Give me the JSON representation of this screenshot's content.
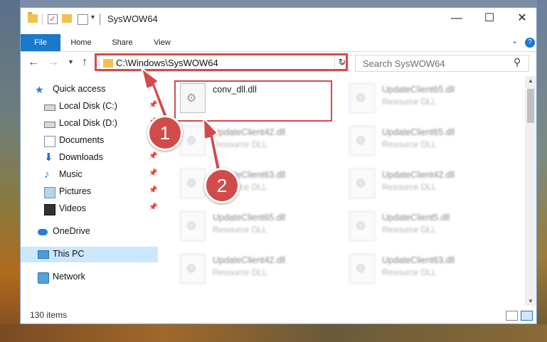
{
  "window": {
    "title": "SysWOW64",
    "minimize_glyph": "—",
    "maximize_glyph": "☐",
    "close_glyph": "✕"
  },
  "ribbon": {
    "tabs": [
      "File",
      "Home",
      "Share",
      "View"
    ]
  },
  "address": {
    "path": "C:\\Windows\\SysWOW64",
    "search_placeholder": "Search SysWOW64"
  },
  "sidebar": {
    "items": [
      {
        "label": "Quick access",
        "icon": "star-icon",
        "pinned": false
      },
      {
        "label": "Local Disk (C:)",
        "icon": "disk-icon",
        "pinned": true
      },
      {
        "label": "Local Disk (D:)",
        "icon": "disk-icon",
        "pinned": true
      },
      {
        "label": "Documents",
        "icon": "documents-icon",
        "pinned": true
      },
      {
        "label": "Downloads",
        "icon": "download-icon",
        "pinned": true
      },
      {
        "label": "Music",
        "icon": "music-icon",
        "pinned": true
      },
      {
        "label": "Pictures",
        "icon": "pictures-icon",
        "pinned": true
      },
      {
        "label": "Videos",
        "icon": "videos-icon",
        "pinned": true
      },
      {
        "label": "OneDrive",
        "icon": "cloud-icon",
        "pinned": false
      },
      {
        "label": "This PC",
        "icon": "computer-icon",
        "pinned": false,
        "selected": true
      },
      {
        "label": "Network",
        "icon": "network-icon",
        "pinned": false
      }
    ]
  },
  "files": {
    "highlighted": {
      "name": "conv_dll.dll"
    },
    "left_column": [
      {
        "name": "UpdateClient42.dll",
        "type": "Resource DLL"
      },
      {
        "name": "UpdateClient63.dll",
        "type": "Resource DLL"
      },
      {
        "name": "UpdateClient65.dll",
        "type": "Resource DLL"
      },
      {
        "name": "UpdateClient42.dll",
        "type": "Resource DLL"
      }
    ],
    "right_column": [
      {
        "name": "UpdateClient65.dll",
        "type": "Resource DLL"
      },
      {
        "name": "UpdateClient65.dll",
        "type": "Resource DLL"
      },
      {
        "name": "UpdateClient42.dll",
        "type": "Resource DLL"
      },
      {
        "name": "UpdateClient5.dll",
        "type": "Resource DLL"
      },
      {
        "name": "UpdateClient63.dll",
        "type": "Resource DLL"
      }
    ]
  },
  "status": {
    "item_count": "130 items"
  },
  "callouts": {
    "one": "1",
    "two": "2"
  },
  "colors": {
    "accent": "#1979ca",
    "highlight": "#d24b4b",
    "selection": "#cce8ff"
  }
}
